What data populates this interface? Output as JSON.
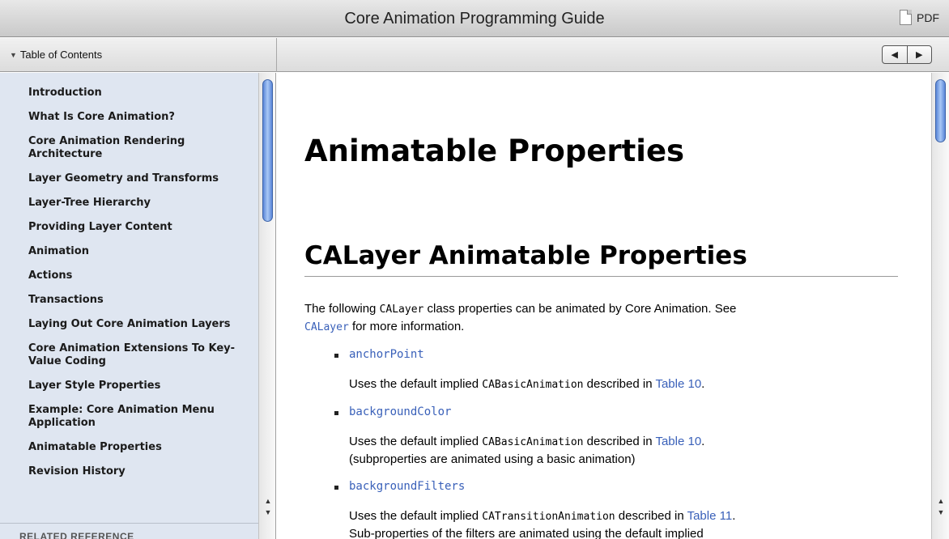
{
  "window": {
    "title": "Core Animation Programming Guide",
    "pdf_label": "PDF"
  },
  "toolbar": {
    "toc_toggle_label": "Table of Contents",
    "prev_icon": "◀",
    "next_icon": "▶"
  },
  "sidebar": {
    "items": [
      {
        "label": "Introduction"
      },
      {
        "label": "What Is Core Animation?"
      },
      {
        "label": "Core Animation Rendering Architecture"
      },
      {
        "label": "Layer Geometry and Transforms"
      },
      {
        "label": "Layer-Tree Hierarchy"
      },
      {
        "label": "Providing Layer Content"
      },
      {
        "label": "Animation"
      },
      {
        "label": "Actions"
      },
      {
        "label": "Transactions"
      },
      {
        "label": "Laying Out Core Animation Layers"
      },
      {
        "label": "Core Animation Extensions To Key-Value Coding"
      },
      {
        "label": "Layer Style Properties"
      },
      {
        "label": "Example: Core Animation Menu Application"
      },
      {
        "label": "Animatable Properties"
      },
      {
        "label": "Revision History"
      }
    ],
    "related_reference": "RELATED REFERENCE"
  },
  "content": {
    "h1": "Animatable Properties",
    "h2": "CALayer Animatable Properties",
    "intro": {
      "before": "The following ",
      "code": "CALayer",
      "after": " class properties can be animated by Core Animation. See ",
      "link": "CALayer",
      "tail": " for more information."
    },
    "properties": [
      {
        "name": "anchorPoint",
        "desc_prefix": "Uses the default implied ",
        "desc_code": "CABasicAnimation",
        "desc_mid": " described in ",
        "desc_link": "Table 10",
        "desc_suffix": ".",
        "desc_line2": ""
      },
      {
        "name": "backgroundColor",
        "desc_prefix": "Uses the default implied ",
        "desc_code": "CABasicAnimation",
        "desc_mid": " described in ",
        "desc_link": "Table 10",
        "desc_suffix": ".",
        "desc_line2": "(subproperties are animated using a basic animation)"
      },
      {
        "name": "backgroundFilters",
        "desc_prefix": "Uses the default implied ",
        "desc_code": "CATransitionAnimation",
        "desc_mid": " described in ",
        "desc_link": "Table 11",
        "desc_suffix": ".",
        "desc_line2": "Sub-properties of the filters are animated using the default implied"
      }
    ]
  },
  "colors": {
    "link": "#3960b9",
    "sidebar_bg": "#dfe6f1",
    "scroll_thumb": "#5a86d8"
  }
}
